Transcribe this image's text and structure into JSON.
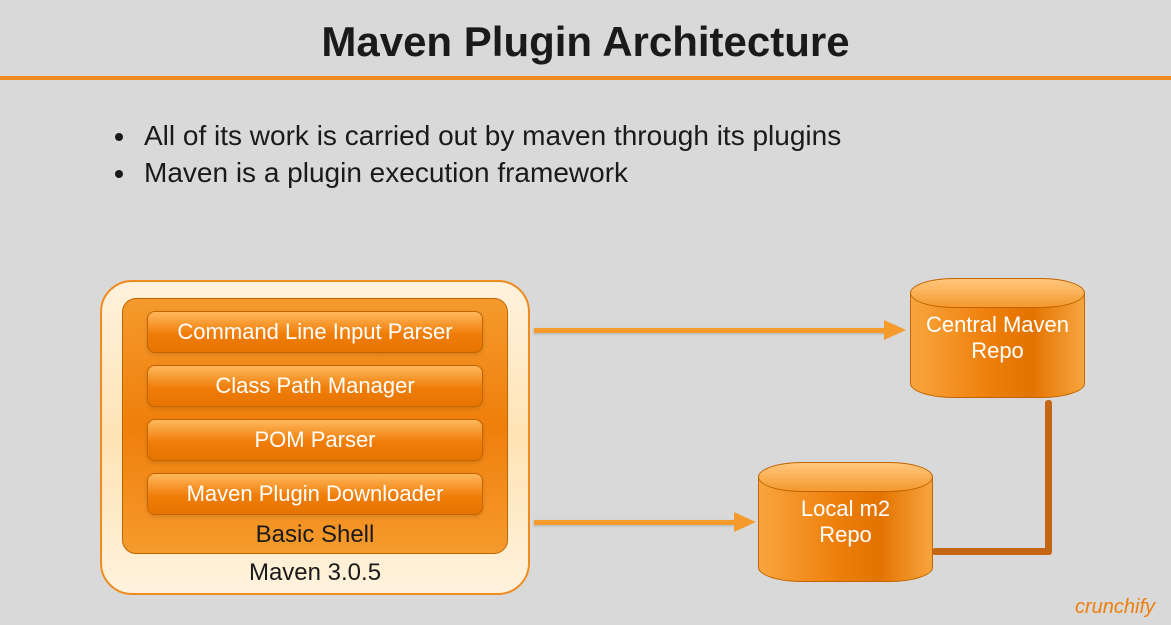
{
  "title": "Maven Plugin Architecture",
  "bullets": [
    "All of its work is carried out by maven through its plugins",
    "Maven is a plugin execution framework"
  ],
  "maven": {
    "outer_label": "Maven 3.0.5",
    "inner_label": "Basic Shell",
    "components": [
      "Command Line Input Parser",
      "Class Path Manager",
      "POM Parser",
      "Maven Plugin Downloader"
    ]
  },
  "repos": {
    "central": {
      "line1": "Central Maven",
      "line2": "Repo"
    },
    "local": {
      "line1": "Local m2",
      "line2": "Repo"
    }
  },
  "watermark": "crunchify"
}
